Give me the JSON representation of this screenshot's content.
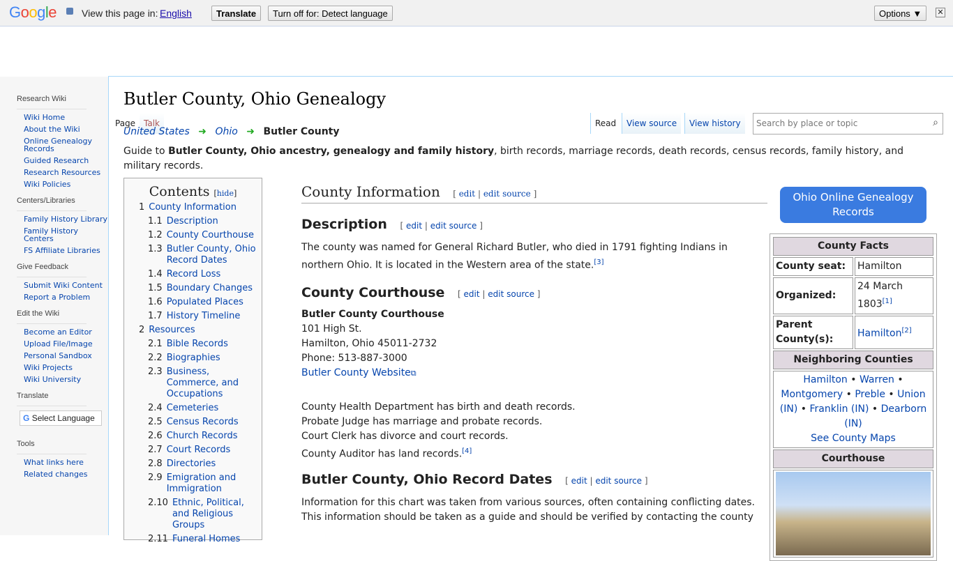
{
  "translate_bar": {
    "logo": "Google",
    "view_label": "View this page in:",
    "language": "English",
    "translate": "Translate",
    "turn_off": "Turn off for: Detect language",
    "options": "Options ▼",
    "close": "✕"
  },
  "sidebar": {
    "sections": [
      {
        "title": "Research Wiki",
        "items": [
          "Wiki Home",
          "About the Wiki",
          "Online Genealogy Records",
          "Guided Research",
          "Research Resources",
          "Wiki Policies"
        ]
      },
      {
        "title": "Centers/Libraries",
        "items": [
          "Family History Library",
          "Family History Centers",
          "FS Affiliate Libraries"
        ]
      },
      {
        "title": "Give Feedback",
        "items": [
          "Submit Wiki Content",
          "Report a Problem"
        ]
      },
      {
        "title": "Edit the Wiki",
        "items": [
          "Become an Editor",
          "Upload File/Image",
          "Personal Sandbox",
          "Wiki Projects",
          "Wiki University"
        ]
      }
    ],
    "translate_title": "Translate",
    "select_language": "Select Language",
    "tools_title": "Tools",
    "tools": [
      "What links here",
      "Related changes"
    ]
  },
  "page": {
    "title": "Butler County, Ohio Genealogy",
    "tabs": {
      "page": "Page",
      "talk": "Talk",
      "read": "Read",
      "view_source": "View source",
      "view_history": "View history"
    },
    "search_placeholder": "Search by place or topic",
    "breadcrumb": [
      "United States",
      "Ohio",
      "Butler County"
    ],
    "intro": {
      "pre": "Guide to ",
      "bold": "Butler County, Ohio ancestry, genealogy and family history",
      "post": ", birth records, marriage records, death records, census records, family history, and military records."
    }
  },
  "toc": {
    "title": "Contents",
    "hide": "hide",
    "items": [
      {
        "n": "1",
        "t": "County Information"
      },
      {
        "n": "1.1",
        "t": "Description"
      },
      {
        "n": "1.2",
        "t": "County Courthouse"
      },
      {
        "n": "1.3",
        "t": "Butler County, Ohio Record Dates"
      },
      {
        "n": "1.4",
        "t": "Record Loss"
      },
      {
        "n": "1.5",
        "t": "Boundary Changes"
      },
      {
        "n": "1.6",
        "t": "Populated Places"
      },
      {
        "n": "1.7",
        "t": "History Timeline"
      },
      {
        "n": "2",
        "t": "Resources"
      },
      {
        "n": "2.1",
        "t": "Bible Records"
      },
      {
        "n": "2.2",
        "t": "Biographies"
      },
      {
        "n": "2.3",
        "t": "Business, Commerce, and Occupations"
      },
      {
        "n": "2.4",
        "t": "Cemeteries"
      },
      {
        "n": "2.5",
        "t": "Census Records"
      },
      {
        "n": "2.6",
        "t": "Church Records"
      },
      {
        "n": "2.7",
        "t": "Court Records"
      },
      {
        "n": "2.8",
        "t": "Directories"
      },
      {
        "n": "2.9",
        "t": "Emigration and Immigration"
      },
      {
        "n": "2.10",
        "t": "Ethnic, Political, and Religious Groups"
      },
      {
        "n": "2.11",
        "t": "Funeral Homes"
      }
    ]
  },
  "main": {
    "edit": "edit",
    "edit_source": "edit source",
    "h_county_info": "County Information",
    "h_description": "Description",
    "description": "The county was named for General Richard Butler, who died in 1791 fighting Indians in northern Ohio. It is located in the Western area of the state.",
    "desc_ref": "[3]",
    "h_courthouse": "County Courthouse",
    "ch_name": "Butler County Courthouse",
    "ch_addr1": "101 High St.",
    "ch_addr2": "Hamilton, Ohio 45011-2732",
    "ch_phone": "Phone: 513-887-3000",
    "ch_website": "Butler County Website",
    "records": [
      "County Health Department has birth and death records.",
      "Probate Judge has marriage and probate records.",
      "Court Clerk has divorce and court records.",
      "County Auditor has land records."
    ],
    "records_ref": "[4]",
    "h_record_dates": "Butler County, Ohio Record Dates",
    "dates_text": "Information for this chart was taken from various sources, often containing conflicting dates. This information should be taken as a guide and should be verified by contacting the county"
  },
  "infobox": {
    "button": "Ohio Online Genealogy Records",
    "facts_title": "County Facts",
    "seat_label": "County seat:",
    "seat": "Hamilton",
    "org_label": "Organized:",
    "org": "24 March 1803",
    "org_ref": "[1]",
    "parent_label": "Parent County(s):",
    "parent": "Hamilton",
    "parent_ref": "[2]",
    "neighbors_title": "Neighboring Counties",
    "neighbors": [
      "Hamilton",
      "Warren",
      "Montgomery",
      "Preble",
      "Union (IN)",
      "Franklin (IN)",
      "Dearborn (IN)"
    ],
    "maps": "See County Maps",
    "courthouse_title": "Courthouse"
  }
}
